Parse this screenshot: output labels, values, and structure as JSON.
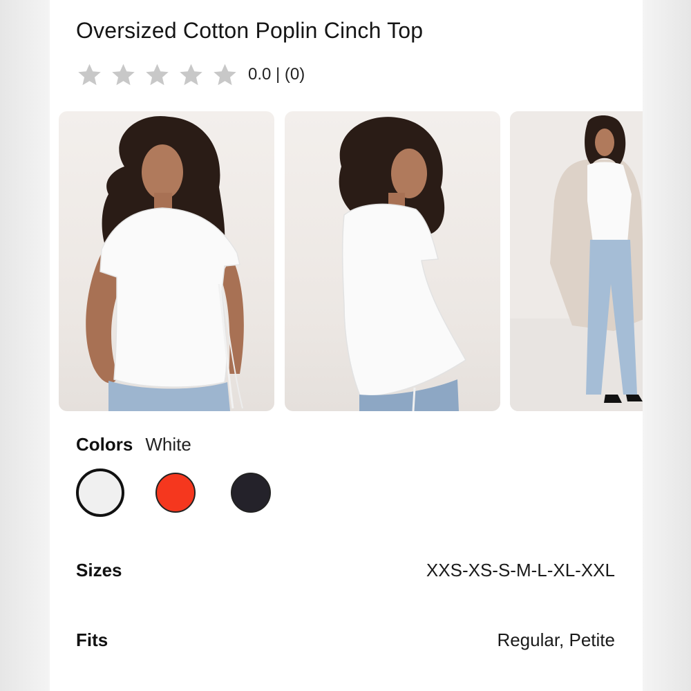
{
  "product": {
    "title": "Oversized Cotton Poplin Cinch Top",
    "rating": {
      "stars_filled": 0,
      "stars_total": 5,
      "text": "0.0 | (0)"
    }
  },
  "gallery": {
    "images": [
      {
        "alt": "Model wearing white top, front view with hand on hip"
      },
      {
        "alt": "Model wearing white top, side view"
      },
      {
        "alt": "Model wearing white top with beige coat and jeans, full length"
      }
    ]
  },
  "colors": {
    "label": "Colors",
    "selected": "White",
    "swatches": [
      {
        "name": "White",
        "hex": "#f0f0f0",
        "selected": true
      },
      {
        "name": "Red",
        "hex": "#f5371e",
        "selected": false
      },
      {
        "name": "Black",
        "hex": "#24222a",
        "selected": false
      }
    ]
  },
  "specs": {
    "sizes": {
      "label": "Sizes",
      "value": "XXS-XS-S-M-L-XL-XXL"
    },
    "fits": {
      "label": "Fits",
      "value": "Regular, Petite"
    }
  },
  "theme": {
    "star_color": "#c8c8c8",
    "text_color": "#111111"
  }
}
